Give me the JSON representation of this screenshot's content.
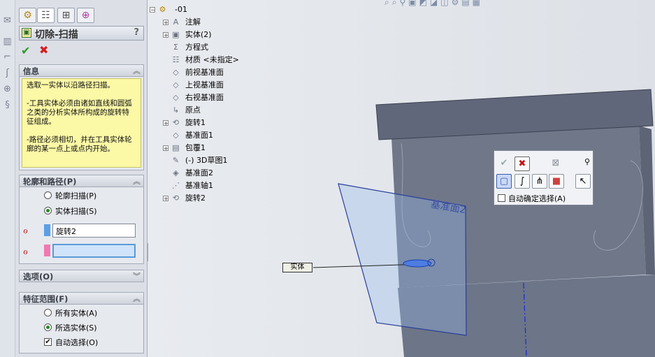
{
  "panel": {
    "title": "切除-扫描",
    "help": "?",
    "ok_symbol": "✔",
    "cancel_symbol": "✖"
  },
  "info": {
    "header": "信息",
    "text": "选取一实体以沿路径扫描。\n\n-工具实体必须由诸如直线和圆弧之类的分析实体所构成的旋转特征组成。\n\n-路径必须相切，并在工具实体轮廓的某一点上或点内开始。"
  },
  "profile_path": {
    "header": "轮廓和路径(P)",
    "option_profile": "轮廓扫描(P)",
    "option_solid": "实体扫描(S)",
    "selected": "solid",
    "tool_body_value": "旋转2",
    "path_value": ""
  },
  "options": {
    "header": "选项(O)"
  },
  "feature_scope": {
    "header": "特征范围(F)",
    "option_all": "所有实体(A)",
    "option_selected": "所选实体(S)",
    "selected": "selected",
    "auto_select_label": "自动选择(O)",
    "auto_select_checked": true,
    "check_mark": "✔"
  },
  "tree": {
    "root": "-01",
    "items": [
      {
        "label": "注解",
        "icon": "annotation-icon",
        "glyph": "A",
        "expand": true
      },
      {
        "label": "实体(2)",
        "icon": "solid-bodies-icon",
        "glyph": "▣",
        "expand": true
      },
      {
        "label": "方程式",
        "icon": "equations-icon",
        "glyph": "Σ",
        "expand": false
      },
      {
        "label": "材质 <未指定>",
        "icon": "material-icon",
        "glyph": "☷",
        "expand": false
      },
      {
        "label": "前视基准面",
        "icon": "plane-icon",
        "glyph": "◇",
        "expand": false
      },
      {
        "label": "上视基准面",
        "icon": "plane-icon",
        "glyph": "◇",
        "expand": false
      },
      {
        "label": "右视基准面",
        "icon": "plane-icon",
        "glyph": "◇",
        "expand": false
      },
      {
        "label": "原点",
        "icon": "origin-icon",
        "glyph": "↳",
        "expand": false
      },
      {
        "label": "旋转1",
        "icon": "revolve-icon",
        "glyph": "⟲",
        "expand": true
      },
      {
        "label": "基准面1",
        "icon": "plane-icon",
        "glyph": "◇",
        "expand": false
      },
      {
        "label": "包覆1",
        "icon": "wrap-icon",
        "glyph": "▤",
        "expand": true
      },
      {
        "label": "(-) 3D草图1",
        "icon": "sketch3d-icon",
        "glyph": "✎",
        "expand": false
      },
      {
        "label": "基准面2",
        "icon": "plane-icon",
        "glyph": "◈",
        "expand": false
      },
      {
        "label": "基准轴1",
        "icon": "axis-icon",
        "glyph": "⋰",
        "expand": false
      },
      {
        "label": "旋转2",
        "icon": "revolve-icon",
        "glyph": "⟲",
        "expand": true
      }
    ]
  },
  "viewport": {
    "plane_label": "基准面2",
    "callout_label": "实体"
  },
  "selection_toolbar": {
    "auto_confirm_label": "自动确定选择(A)"
  },
  "colors": {
    "panel_bg": "#dcdfe6",
    "info_bg": "#fbf8a6",
    "body_face": "#6b7385",
    "body_top": "#5a6173",
    "plane": "#3b52a8",
    "accent_green": "#2a9b2a",
    "accent_red": "#d32020"
  }
}
